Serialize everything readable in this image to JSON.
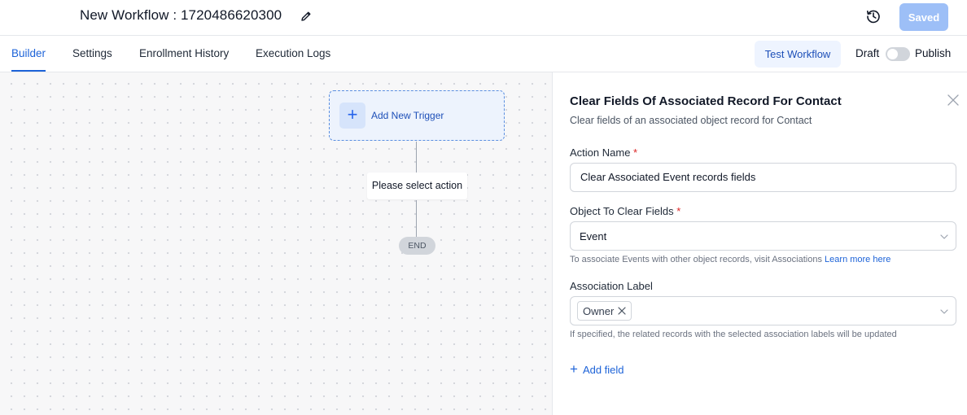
{
  "header": {
    "title": "New Workflow : 1720486620300",
    "saved_label": "Saved"
  },
  "tabs": [
    {
      "label": "Builder",
      "active": true
    },
    {
      "label": "Settings",
      "active": false
    },
    {
      "label": "Enrollment History",
      "active": false
    },
    {
      "label": "Execution Logs",
      "active": false
    }
  ],
  "toolbar": {
    "test_label": "Test Workflow",
    "draft_label": "Draft",
    "publish_label": "Publish",
    "publish_toggle_on": false
  },
  "canvas": {
    "trigger_label": "Add New Trigger",
    "action_label": "Please select action",
    "end_label": "END"
  },
  "panel": {
    "title": "Clear Fields Of Associated Record For Contact",
    "subtitle": "Clear fields of an associated object record for Contact",
    "action_name": {
      "label": "Action Name",
      "required_mark": "*",
      "value": "Clear Associated Event records fields"
    },
    "object": {
      "label": "Object To Clear Fields",
      "required_mark": "*",
      "value": "Event",
      "help": "To associate Events with other object records, visit Associations",
      "help_link": "Learn more here"
    },
    "association": {
      "label": "Association Label",
      "chip": "Owner",
      "help": "If specified, the related records with the selected association labels will be updated"
    },
    "add_field_label": "Add field"
  },
  "colors": {
    "accent": "#1d63d8",
    "saved_button": "#9dbff7",
    "required": "#dc2626"
  },
  "icons": [
    "pencil-icon",
    "history-icon",
    "plus-icon",
    "close-icon",
    "chevron-down-icon",
    "x-icon"
  ]
}
